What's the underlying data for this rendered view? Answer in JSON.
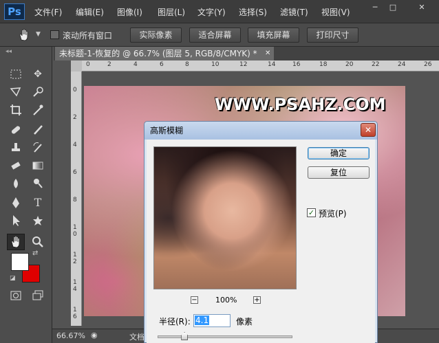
{
  "app": {
    "logo": "Ps"
  },
  "menu": [
    "文件(F)",
    "编辑(E)",
    "图像(I)",
    "图层(L)",
    "文字(Y)",
    "选择(S)",
    "滤镜(T)",
    "视图(V)"
  ],
  "window_controls": {
    "minimize": "─",
    "maximize": "□",
    "close": "✕"
  },
  "options_bar": {
    "tool_icon": "hand-icon",
    "scroll_all_label": "滚动所有窗口",
    "buttons": [
      "实际像素",
      "适合屏幕",
      "填充屏幕",
      "打印尺寸"
    ]
  },
  "document_tab": {
    "title": "未标题-1-恢复的 @ 66.7% (图层 5, RGB/8/CMYK) *",
    "close": "✕"
  },
  "ruler": {
    "top": [
      "0",
      "2",
      "4",
      "6",
      "8",
      "10",
      "12",
      "14",
      "16",
      "18",
      "20",
      "22",
      "24",
      "26"
    ],
    "left": [
      "0",
      "2",
      "4",
      "6",
      "8",
      "1 0",
      "1 2",
      "1 4",
      "1 6"
    ]
  },
  "canvas": {
    "watermark": "WWW.PSAHZ.COM"
  },
  "status": {
    "zoom": "66.67%",
    "doc_label": "文档"
  },
  "dialog": {
    "title": "高斯模糊",
    "close": "✕",
    "ok_label": "确定",
    "reset_label": "复位",
    "preview_checked": "✓",
    "preview_label": "预览(P)",
    "zoom_out": "−",
    "zoom_level": "100%",
    "zoom_in": "+",
    "radius_label": "半径(R):",
    "radius_value": "4.1",
    "radius_unit": "像素",
    "slider_fraction": 0.2
  },
  "colors": {
    "foreground": "#ffffff",
    "background": "#e00000",
    "accent": "#3399ff"
  }
}
